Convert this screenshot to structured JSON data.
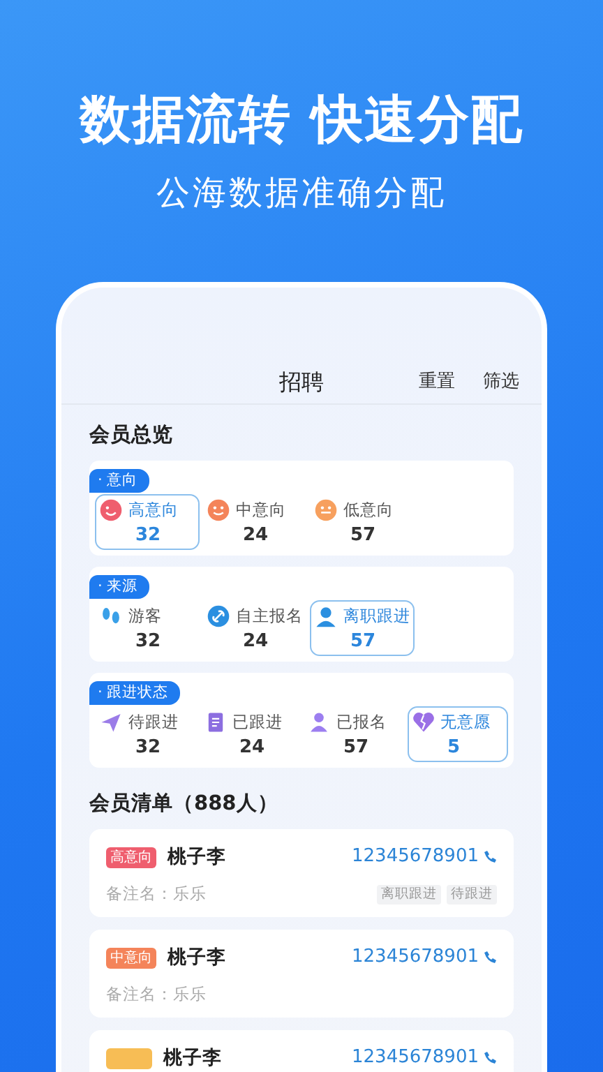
{
  "hero": {
    "title": "数据流转 快速分配",
    "subtitle": "公海数据准确分配"
  },
  "nav": {
    "title": "招聘",
    "actions": [
      "重置",
      "筛选"
    ]
  },
  "overview": {
    "title": "会员总览",
    "groups": [
      {
        "label": "· 意向",
        "items": [
          {
            "label": "高意向",
            "count": "32",
            "selected": true
          },
          {
            "label": "中意向",
            "count": "24",
            "selected": false
          },
          {
            "label": "低意向",
            "count": "57",
            "selected": false
          }
        ]
      },
      {
        "label": "· 来源",
        "items": [
          {
            "label": "游客",
            "count": "32",
            "selected": false
          },
          {
            "label": "自主报名",
            "count": "24",
            "selected": false
          },
          {
            "label": "离职跟进",
            "count": "57",
            "selected": true
          }
        ]
      },
      {
        "label": "· 跟进状态",
        "items": [
          {
            "label": "待跟进",
            "count": "32",
            "selected": false
          },
          {
            "label": "已跟进",
            "count": "24",
            "selected": false
          },
          {
            "label": "已报名",
            "count": "57",
            "selected": false
          },
          {
            "label": "无意愿",
            "count": "5",
            "selected": true
          }
        ]
      }
    ]
  },
  "members": {
    "title": "会员清单（888人）",
    "items": [
      {
        "tag": {
          "text": "高意向",
          "color": "#ef5e6e"
        },
        "name": "桃子李",
        "phone": "12345678901",
        "note": "备注名：乐乐",
        "labels": [
          "离职跟进",
          "待跟进"
        ]
      },
      {
        "tag": {
          "text": "中意向",
          "color": "#f4845a"
        },
        "name": "桃子李",
        "phone": "12345678901",
        "note": "备注名：乐乐"
      },
      {
        "tag": {
          "color": "#f7bd55"
        },
        "name": "桃子李",
        "phone": "12345678901"
      }
    ]
  }
}
